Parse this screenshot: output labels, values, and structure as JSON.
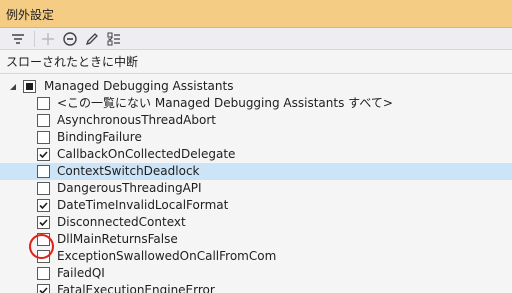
{
  "window": {
    "title": "例外設定"
  },
  "toolbar": {
    "filter_icon": "filter-icon",
    "add_icon": "plus-icon",
    "remove_icon": "minus-circle-icon",
    "edit_icon": "pencil-icon",
    "restore_icon": "checklist-icon"
  },
  "section": {
    "label": "スローされたときに中断"
  },
  "tree": {
    "root": {
      "label": "Managed Debugging Assistants",
      "expanded": true,
      "state": "indeterminate"
    },
    "items": [
      {
        "label": "<この一覧にない Managed Debugging Assistants すべて>",
        "checked": false
      },
      {
        "label": "AsynchronousThreadAbort",
        "checked": false
      },
      {
        "label": "BindingFailure",
        "checked": false
      },
      {
        "label": "CallbackOnCollectedDelegate",
        "checked": true
      },
      {
        "label": "ContextSwitchDeadlock",
        "checked": false,
        "selected": true
      },
      {
        "label": "DangerousThreadingAPI",
        "checked": false
      },
      {
        "label": "DateTimeInvalidLocalFormat",
        "checked": true
      },
      {
        "label": "DisconnectedContext",
        "checked": true
      },
      {
        "label": "DllMainReturnsFalse",
        "checked": false
      },
      {
        "label": "ExceptionSwallowedOnCallFromCom",
        "checked": false
      },
      {
        "label": "FailedQI",
        "checked": false
      },
      {
        "label": "FatalExecutionEngineError",
        "checked": true
      }
    ]
  },
  "colors": {
    "titlebar": "#f5cc84",
    "selection": "#cce4f7",
    "annotation": "#e0201a"
  }
}
